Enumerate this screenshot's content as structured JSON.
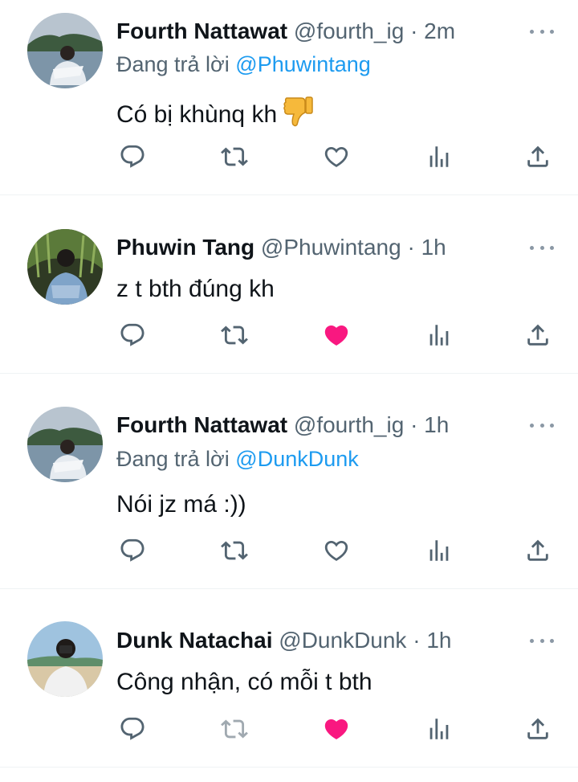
{
  "colors": {
    "text": "#0f1419",
    "secondary": "#536471",
    "mention": "#1d9bf0",
    "liked": "#f91880",
    "divider": "#eff3f4"
  },
  "reply_prefix": "Đang trả lời",
  "tweets": [
    {
      "name": "Fourth Nattawat",
      "handle": "@fourth_ig",
      "dot": "·",
      "time": "2m",
      "reply_to": "@Phuwintang",
      "text": "Có bị khùnq kh",
      "emoji": "thumbs-down-icon",
      "liked": false
    },
    {
      "name": "Phuwin Tang",
      "handle": "@Phuwintang",
      "dot": "·",
      "time": "1h",
      "reply_to": "",
      "text": "z t bth đúng kh",
      "liked": true
    },
    {
      "name": "Fourth Nattawat",
      "handle": "@fourth_ig",
      "dot": "·",
      "time": "1h",
      "reply_to": "@DunkDunk",
      "text": "Nói jz má :))",
      "liked": false
    },
    {
      "name": "Dunk Natachai",
      "handle": "@DunkDunk",
      "dot": "·",
      "time": "1h",
      "reply_to": "",
      "text": "Công nhận, có mỗi t bth",
      "liked": true
    }
  ]
}
